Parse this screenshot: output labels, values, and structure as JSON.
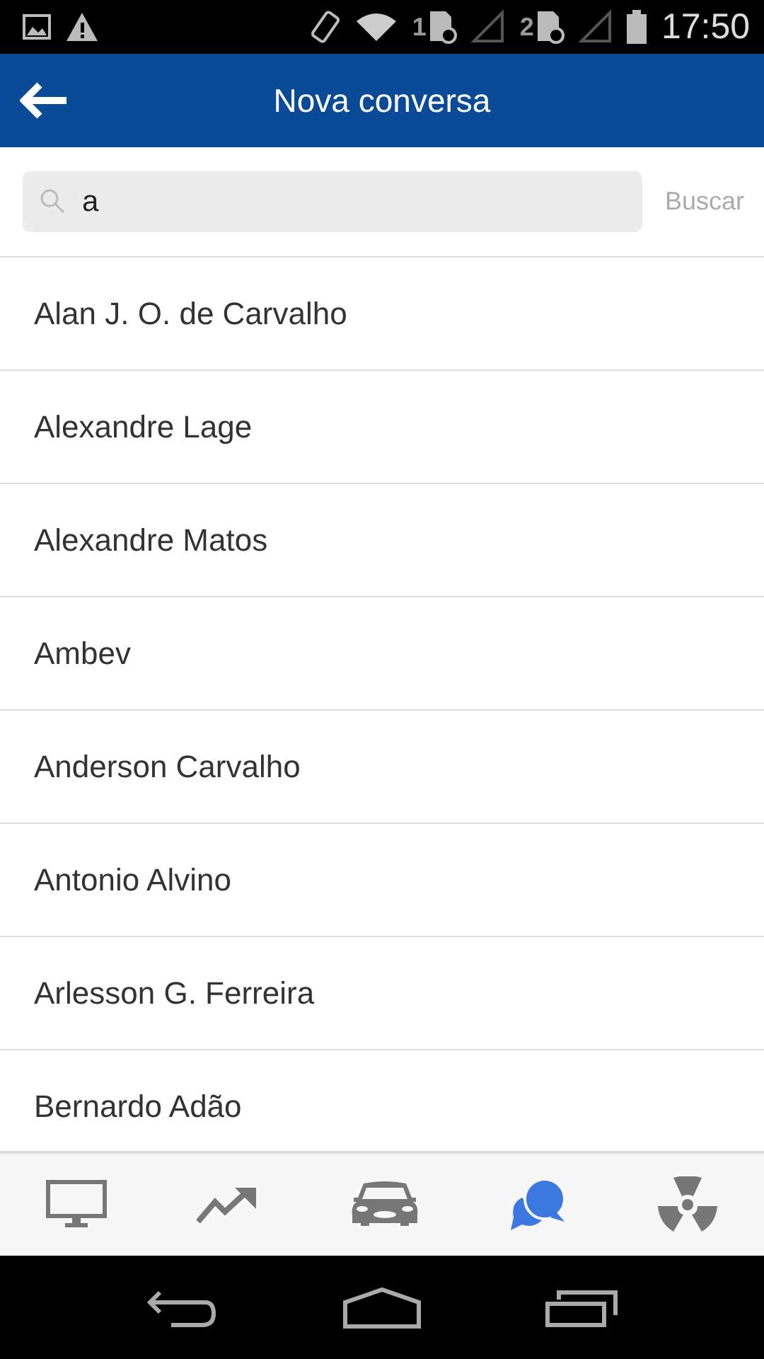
{
  "status_bar": {
    "sim_1": "1",
    "sim_2": "2",
    "time": "17:50"
  },
  "header": {
    "title": "Nova conversa"
  },
  "search": {
    "value": "a",
    "button": "Buscar"
  },
  "contacts": [
    "Alan J. O. de Carvalho",
    "Alexandre Lage",
    "Alexandre Matos",
    "Ambev",
    "Anderson Carvalho",
    "Antonio Alvino",
    "Arlesson G. Ferreira",
    "Bernardo Adão"
  ],
  "tabs": [
    {
      "kind": "monitor",
      "selected": false
    },
    {
      "kind": "trend",
      "selected": false
    },
    {
      "kind": "car",
      "selected": false
    },
    {
      "kind": "chat",
      "selected": true
    },
    {
      "kind": "radiation",
      "selected": false
    }
  ]
}
